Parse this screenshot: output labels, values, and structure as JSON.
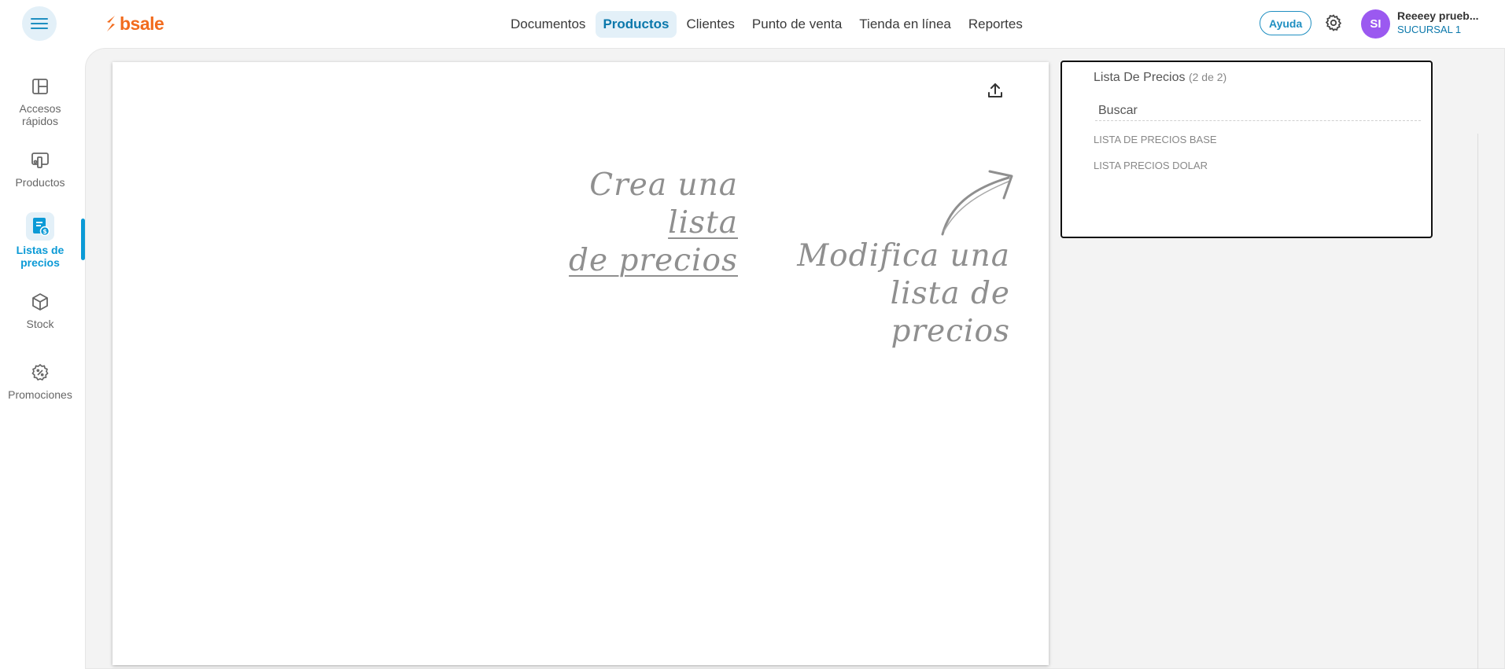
{
  "brand": {
    "name": "bsale",
    "accent": "#f26b1d"
  },
  "header": {
    "menu_icon": "hamburger-menu-icon",
    "nav": [
      {
        "label": "Documentos",
        "active": false
      },
      {
        "label": "Productos",
        "active": true
      },
      {
        "label": "Clientes",
        "active": false
      },
      {
        "label": "Punto de venta",
        "active": false
      },
      {
        "label": "Tienda en línea",
        "active": false
      },
      {
        "label": "Reportes",
        "active": false
      }
    ],
    "help_label": "Ayuda",
    "settings_icon": "gear-icon",
    "user": {
      "initials": "SI",
      "name": "Reeeey prueb...",
      "branch": "SUCURSAL 1",
      "avatar_color": "#9b59f0"
    }
  },
  "sidebar": {
    "items": [
      {
        "label_line1": "Accesos",
        "label_line2": "rápidos",
        "icon": "layout-grid-icon",
        "active": false
      },
      {
        "label_line1": "Productos",
        "label_line2": "",
        "icon": "devices-icon",
        "active": false
      },
      {
        "label_line1": "Listas de",
        "label_line2": "precios",
        "icon": "price-list-icon",
        "active": true
      },
      {
        "label_line1": "Stock",
        "label_line2": "",
        "icon": "cube-icon",
        "active": false
      },
      {
        "label_line1": "Promociones",
        "label_line2": "",
        "icon": "discount-badge-icon",
        "active": false
      }
    ],
    "active_color": "#0b9ad6"
  },
  "canvas": {
    "export_icon": "upload-icon",
    "hint_create": {
      "line1_plain": "Crea una ",
      "line1_underlined": "lista",
      "line2_underlined": "de precios"
    },
    "hint_modify": {
      "line1": "Modifica una",
      "line2": "lista de precios"
    },
    "arrow_icon": "curved-arrow-icon"
  },
  "price_panel": {
    "title": "Lista De Precios",
    "count": "(2 de 2)",
    "search_placeholder": "Buscar",
    "items": [
      {
        "label": "LISTA DE PRECIOS BASE"
      },
      {
        "label": "LISTA PRECIOS DOLAR"
      }
    ]
  }
}
